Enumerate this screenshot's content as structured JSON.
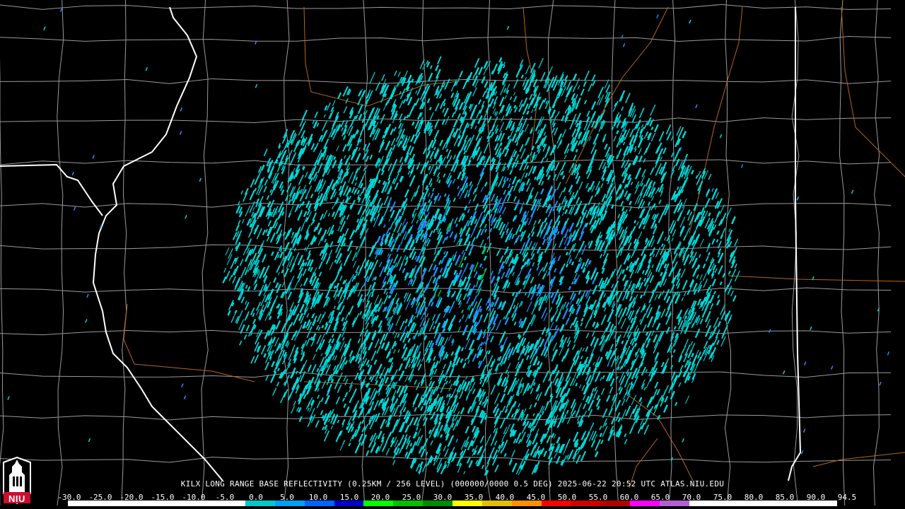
{
  "caption": "KILX LONG RANGE BASE REFLECTIVITY (0.25KM / 256 LEVEL) (000000/0000 0.5 DEG) 2025-06-22 20:52 UTC  ATLAS.NIU.EDU",
  "scale": {
    "labels": [
      "-30.0",
      "-25.0",
      "-20.0",
      "-15.0",
      "-10.0",
      "-5.0",
      "0.0",
      "5.0",
      "10.0",
      "15.0",
      "20.0",
      "25.0",
      "30.0",
      "35.0",
      "40.0",
      "45.0",
      "50.0",
      "55.0",
      "60.0",
      "65.0",
      "70.0",
      "75.0",
      "80.0",
      "85.0",
      "90.0",
      "94.5"
    ],
    "colors": [
      "#000000",
      "#000000",
      "#000000",
      "#000000",
      "#000000",
      "#000000",
      "#00c8c8",
      "#00a0f0",
      "#0064ff",
      "#0000c8",
      "#00ff00",
      "#00c000",
      "#008c00",
      "#ffff00",
      "#e0c000",
      "#ff9000",
      "#ff0000",
      "#d00000",
      "#b00000",
      "#ff00ff",
      "#b060d0",
      "#ffffff",
      "#ffffff",
      "#ffffff",
      "#ffffff",
      "#ffffff"
    ]
  },
  "logo": {
    "text": "NIU",
    "colors": {
      "shield": "#c8102e",
      "tower": "#ffffff"
    }
  },
  "map": {
    "radar_site": "KILX",
    "colors": {
      "state_border": "#ffffff",
      "county_border": "#9a9a9a",
      "highway": "#b5651d",
      "echo_primary": "#00d8d8",
      "echo_secondary": "#1e90ff",
      "echo_strong": "#00c000"
    }
  }
}
